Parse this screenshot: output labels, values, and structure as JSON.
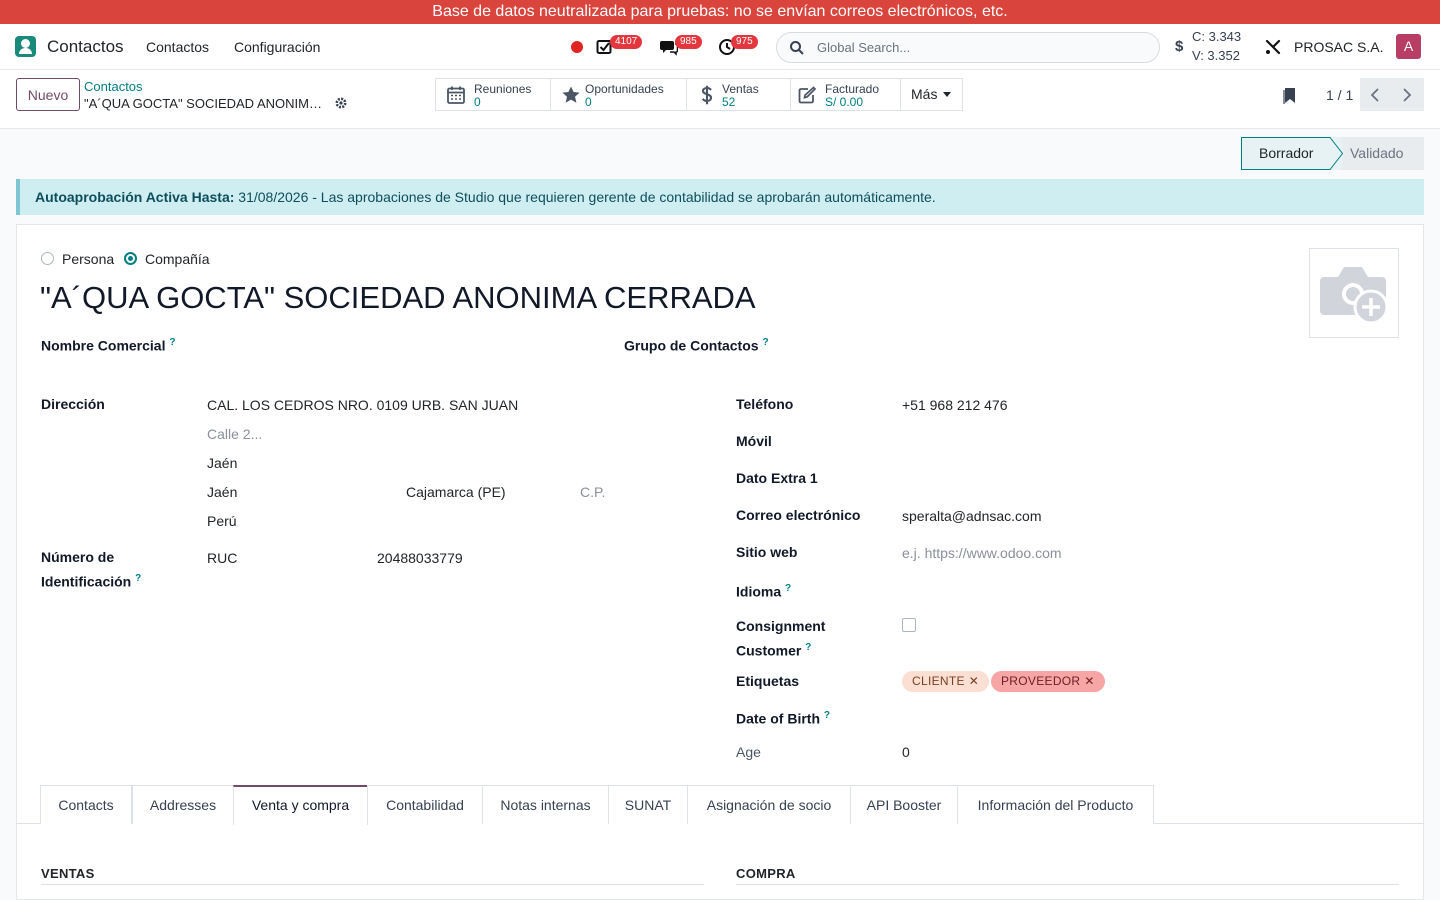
{
  "banner": {
    "text": "Base de datos neutralizada para pruebas: no se envían correos electrónicos, etc."
  },
  "navbar": {
    "app_name": "Contactos",
    "menus": [
      "Contactos",
      "Configuración"
    ],
    "badges": {
      "activities": "4107",
      "messages": "985",
      "tasks": "975"
    },
    "search_placeholder": "Global Search...",
    "rates": {
      "sign": "$",
      "buy": "C: 3.343",
      "sell": "V: 3.352"
    },
    "company": "PROSAC S.A.",
    "avatar": "A",
    "record_color": "#e02424",
    "avatar_color": "#b83e66"
  },
  "control_panel": {
    "new_button": "Nuevo",
    "breadcrumb_parent": "Contactos",
    "breadcrumb_current": "\"A´QUA GOCTA\" SOCIEDAD ANONIMA CERRADA",
    "smart_buttons": [
      {
        "icon": "calendar-icon",
        "label": "Reuniones",
        "value": "0"
      },
      {
        "icon": "star-icon",
        "label": "Oportunidades",
        "value": "0"
      },
      {
        "icon": "dollar-icon",
        "label": "Ventas",
        "value": "52"
      },
      {
        "icon": "edit-icon",
        "label": "Facturado",
        "value": "S/ 0.00"
      }
    ],
    "more_label": "Más",
    "pager": "1 / 1"
  },
  "statusbar": {
    "draft": "Borrador",
    "validated": "Validado"
  },
  "alert": {
    "bold": "Autoaprobación Activa Hasta:",
    "text": " 31/08/2026 - Las aprobaciones de Studio que requieren gerente de contabilidad se aprobarán automáticamente."
  },
  "form": {
    "type_person": "Persona",
    "type_company": "Compañía",
    "name": "\"A´QUA GOCTA\" SOCIEDAD ANONIMA CERRADA",
    "trade_name_label": "Nombre Comercial",
    "contact_group_label": "Grupo de Contactos",
    "address": {
      "label": "Dirección",
      "street": "CAL. LOS CEDROS NRO. 0109 URB. SAN JUAN",
      "street2_placeholder": "Calle 2...",
      "district": "Jaén",
      "city": "Jaén",
      "state": "Cajamarca (PE)",
      "zip_placeholder": "C.P.",
      "country": "Perú"
    },
    "identification": {
      "label_line1": "Número de",
      "label_line2": "Identificación",
      "type": "RUC",
      "number": "20488033779"
    },
    "right": {
      "phone_label": "Teléfono",
      "phone": "+51 968 212 476",
      "mobile_label": "Móvil",
      "extra_label": "Dato Extra 1",
      "email_label": "Correo electrónico",
      "email": "speralta@adnsac.com",
      "website_label": "Sitio web",
      "website_placeholder": "e.j. https://www.odoo.com",
      "language_label": "Idioma",
      "consignment_label_line1": "Consignment",
      "consignment_label_line2": "Customer",
      "tags_label": "Etiquetas",
      "tags": [
        {
          "name": "CLIENTE",
          "bg": "#fadfd2",
          "fg": "#7a3f23"
        },
        {
          "name": "PROVEEDOR",
          "bg": "#f8a5a6",
          "fg": "#6b1f23"
        }
      ],
      "dob_label": "Date of Birth",
      "age_label": "Age",
      "age": "0"
    },
    "help_mark": "?"
  },
  "tabs": [
    "Contacts",
    "Addresses",
    "Venta y compra",
    "Contabilidad",
    "Notas internas",
    "SUNAT",
    "Asignación de socio",
    "API Booster",
    "Información del Producto"
  ],
  "active_tab": "Venta y compra",
  "sections": {
    "sales": "VENTAS",
    "purchase": "COMPRA"
  },
  "colors": {
    "primary": "#714b67",
    "accent": "#017e84",
    "banner": "#d9443c"
  }
}
